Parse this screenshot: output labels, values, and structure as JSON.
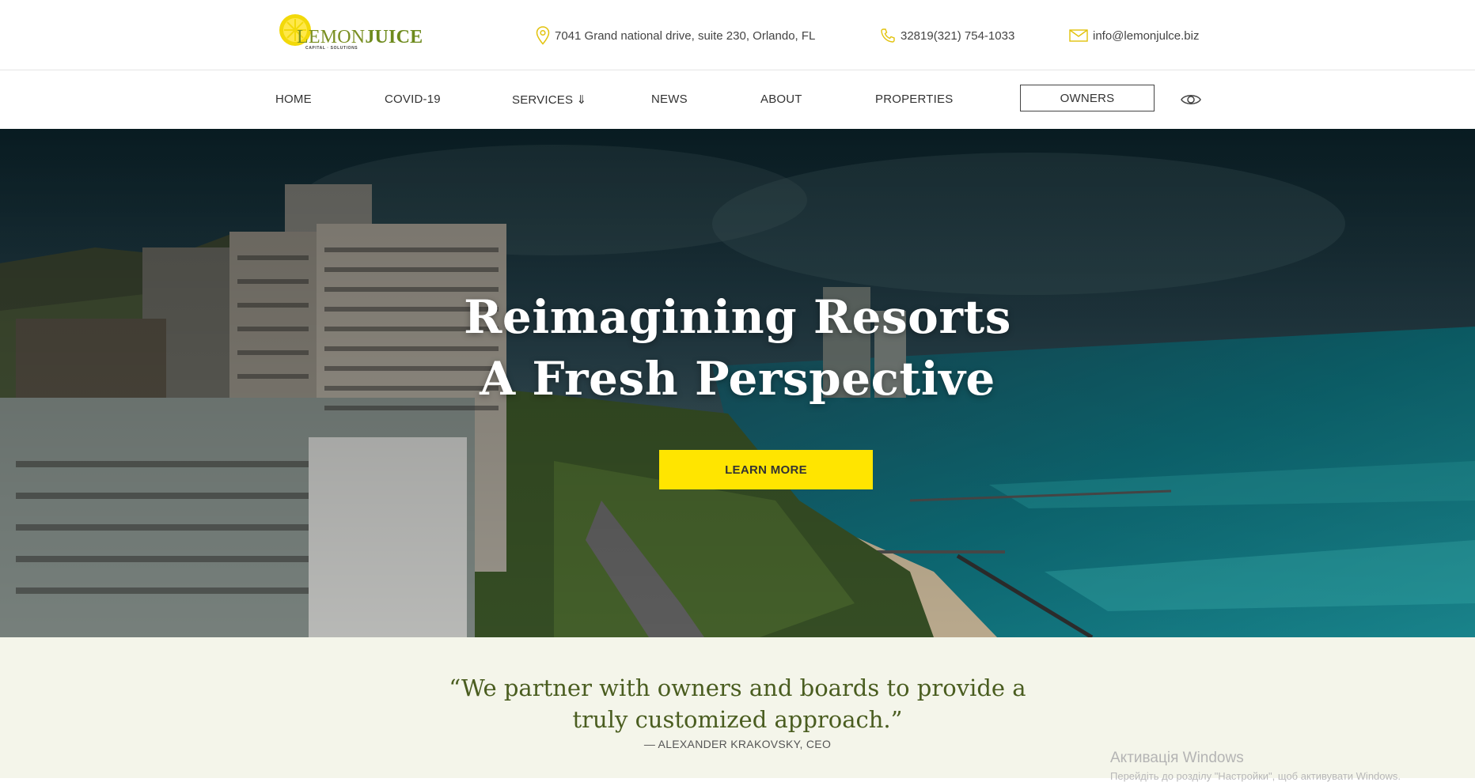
{
  "header": {
    "logo": {
      "lemon": "LEMON",
      "juice": "JUICE",
      "tagline": "CAPITAL · SOLUTIONS"
    },
    "address": "7041 Grand national drive, suite 230, Orlando, FL",
    "phone": "32819(321) 754-1033",
    "email": "info@lemonjulce.biz"
  },
  "nav": {
    "items": [
      "HOME",
      "COVID-19",
      "SERVICES ⇓",
      "NEWS",
      "ABOUT",
      "PROPERTIES"
    ],
    "owners_label": "OWNERS"
  },
  "hero": {
    "title_line1": "Reimagining Resorts",
    "title_line2": "A Fresh Perspective",
    "cta_label": "LEARN MORE"
  },
  "quote": {
    "text": "“We partner with owners and boards to provide a truly customized approach.”",
    "author": "— ALEXANDER KRAKOVSKY, CEO"
  },
  "system": {
    "watermark_title": "Активація Windows",
    "watermark_sub": "Перейдіть до розділу \"Настройки\", щоб активувати Windows."
  },
  "colors": {
    "accent_yellow": "#ffe500",
    "brand_green": "#6d8a1c",
    "quote_bg": "#f4f5ea"
  }
}
